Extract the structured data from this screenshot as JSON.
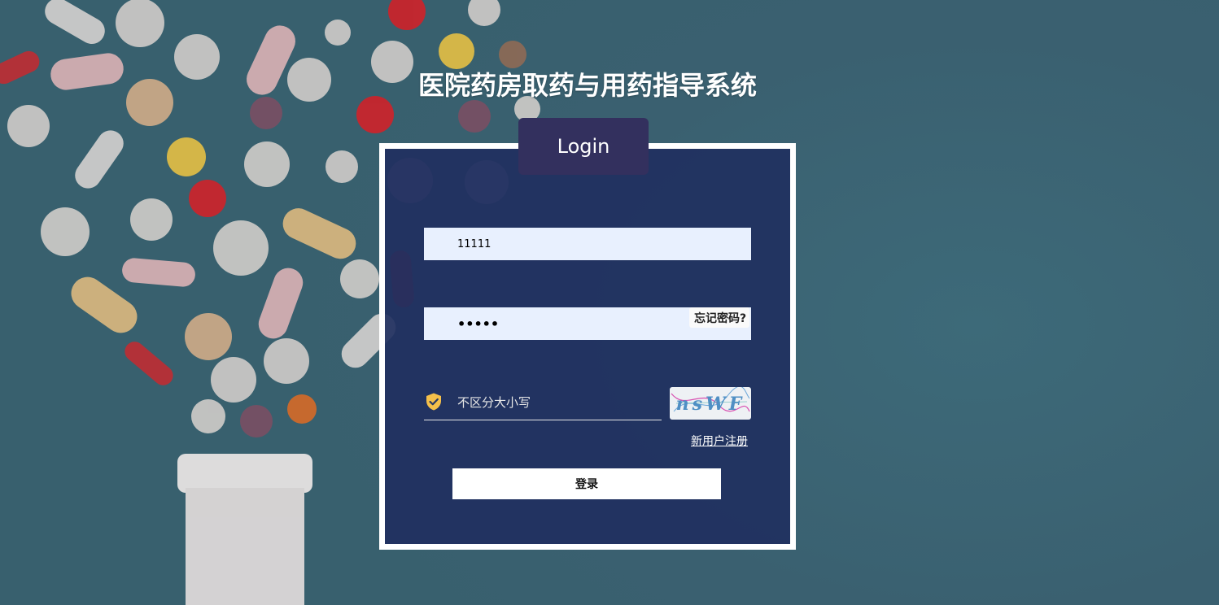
{
  "page": {
    "title": "医院药房取药与用药指导系统"
  },
  "login": {
    "tab_label": "Login",
    "username_value": "11111",
    "password_value": "•••••",
    "forgot_password_label": "忘记密码?",
    "captcha_placeholder": "不区分大小写",
    "captcha_text": "nsWF",
    "register_label": "新用户注册",
    "submit_label": "登录"
  },
  "colors": {
    "background": "#3f6b7a",
    "card": "#213060",
    "tab": "#33305e",
    "field": "#e8f0fe",
    "shield_icon": "#f5c04a"
  },
  "icons": {
    "captcha_field": "shield-check-icon"
  }
}
